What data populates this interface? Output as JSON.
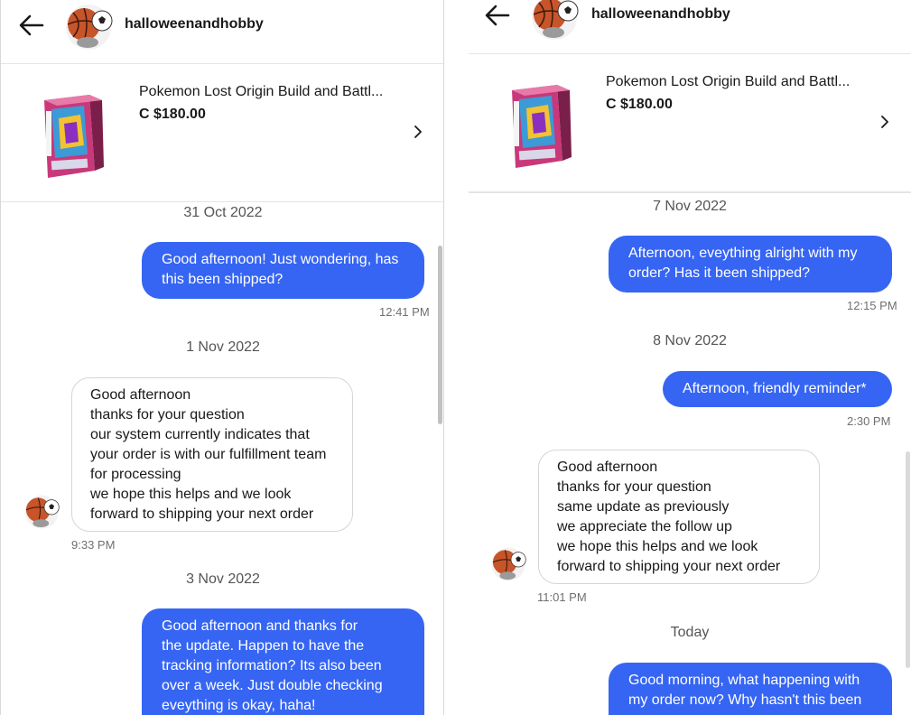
{
  "left": {
    "header": {
      "username": "halloweenandhobby"
    },
    "listing": {
      "title": "Pokemon Lost Origin Build and Battl...",
      "price": "C $180.00"
    },
    "messages": {
      "date1": "31 Oct 2022",
      "m1": {
        "lines": [
          "Good afternoon! Just wondering, has",
          "this been shipped?"
        ],
        "time": "12:41 PM"
      },
      "date2": "1 Nov 2022",
      "m2": {
        "lines": [
          "Good afternoon",
          "thanks for your question",
          "our system currently indicates that",
          "your order is with our fulfillment team",
          "for processing",
          "we hope this helps and we look",
          "forward to shipping your next order"
        ],
        "time": "9:33 PM"
      },
      "date3": "3 Nov 2022",
      "m3": {
        "lines": [
          "Good afternoon and thanks for",
          "the update. Happen to have the",
          "tracking information? Its also been",
          "over a week. Just double checking",
          "eveything is okay, haha!"
        ]
      }
    }
  },
  "right": {
    "header": {
      "username": "halloweenandhobby"
    },
    "listing": {
      "title": "Pokemon Lost Origin Build and Battl...",
      "price": "C $180.00"
    },
    "messages": {
      "date1": "7 Nov 2022",
      "m1": {
        "lines": [
          "Afternoon, eveything alright with my",
          "order? Has it been shipped?"
        ],
        "time": "12:15 PM"
      },
      "date2": "8 Nov 2022",
      "m2": {
        "lines": [
          "Afternoon, friendly reminder*"
        ],
        "time": "2:30 PM"
      },
      "m3": {
        "lines": [
          "Good afternoon",
          "thanks for your question",
          "same update as previously",
          "we appreciate the follow up",
          "we hope this helps and we look",
          "forward to shipping your next order"
        ],
        "time": "11:01 PM"
      },
      "date3": "Today",
      "m4": {
        "lines": [
          "Good morning, what happening with",
          "my order now? Why hasn't this been"
        ]
      }
    }
  },
  "colors": {
    "accent": "#3665f3",
    "text": "#191919",
    "muted": "#6f6f6f"
  },
  "icons": [
    "back-arrow-icon",
    "chevron-right-icon",
    "sports-balls-avatar"
  ]
}
